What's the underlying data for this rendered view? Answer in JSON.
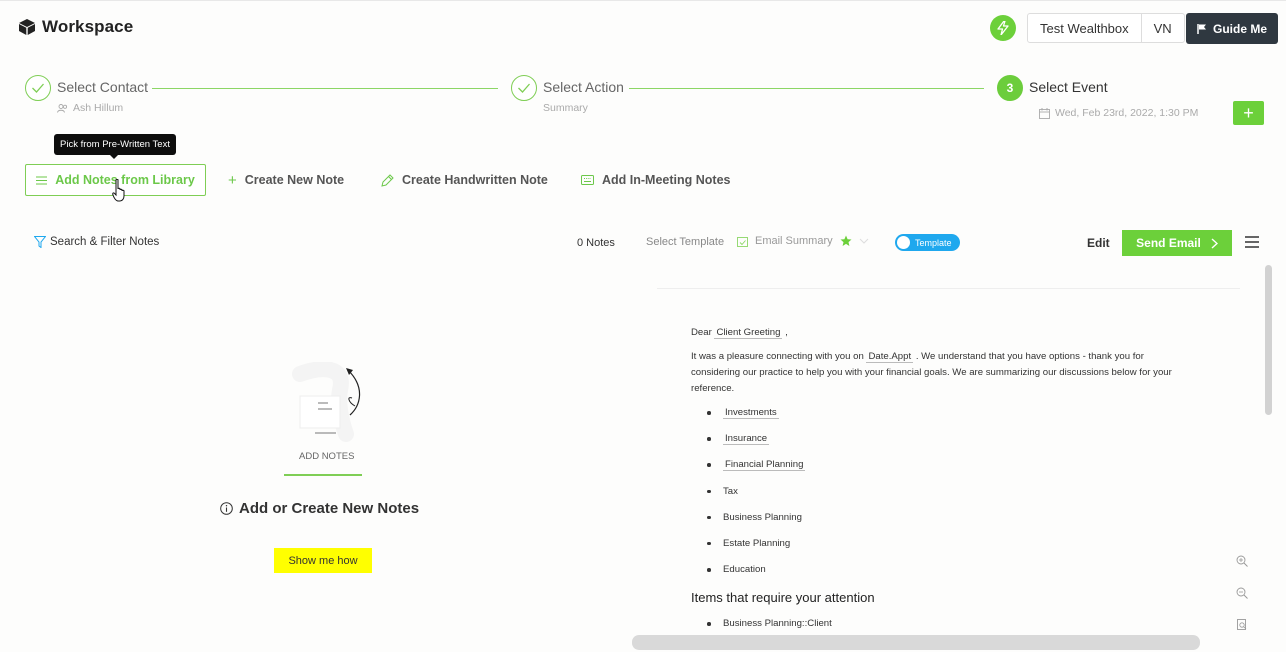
{
  "header": {
    "brand": "Workspace",
    "account": "Test Wealthbox",
    "user": "VN",
    "guide": "Guide Me"
  },
  "stepper": {
    "steps": [
      {
        "title": "Select Contact",
        "subtitle": "Ash Hillum",
        "state": "done"
      },
      {
        "title": "Select Action",
        "subtitle": "Summary",
        "state": "done"
      },
      {
        "number": "3",
        "title": "Select Event",
        "subtitle": "Wed, Feb 23rd, 2022, 1:30 PM",
        "state": "active"
      }
    ]
  },
  "tooltip": "Pick from Pre-Written Text",
  "actions": {
    "library": "Add Notes from Library",
    "create": "Create New Note",
    "handwritten": "Create Handwritten Note",
    "meeting": "Add In-Meeting Notes"
  },
  "toolbar": {
    "filter": "Search & Filter Notes",
    "count": "0 Notes",
    "template_label": "Select Template",
    "template_value": "Email Summary",
    "toggle_label": "Template",
    "edit": "Edit",
    "send": "Send Email"
  },
  "empty": {
    "label": "ADD NOTES",
    "title": "Add or Create New Notes",
    "button": "Show me how"
  },
  "email": {
    "greeting_prefix": "Dear",
    "greeting_token": "Client Greeting",
    "greeting_suffix": ",",
    "intro_prefix": "It was a pleasure connecting with you on",
    "intro_token": "Date.Appt",
    "intro_suffix": ". We understand that you have options - thank you for considering our practice to help you with your financial goals. We are summarizing our discussions below for your reference.",
    "topics": [
      "Investments",
      "Insurance",
      "Financial Planning",
      "Tax",
      "Business Planning",
      "Estate Planning",
      "Education"
    ],
    "attention_heading": "Items that require your attention",
    "attention_items": [
      "Business Planning::Client"
    ]
  },
  "colors": {
    "accent_green": "#6cd03a",
    "toggle_blue": "#1fa8ee",
    "guide_dark": "#2f3840",
    "highlight_yellow": "#ffff00"
  }
}
